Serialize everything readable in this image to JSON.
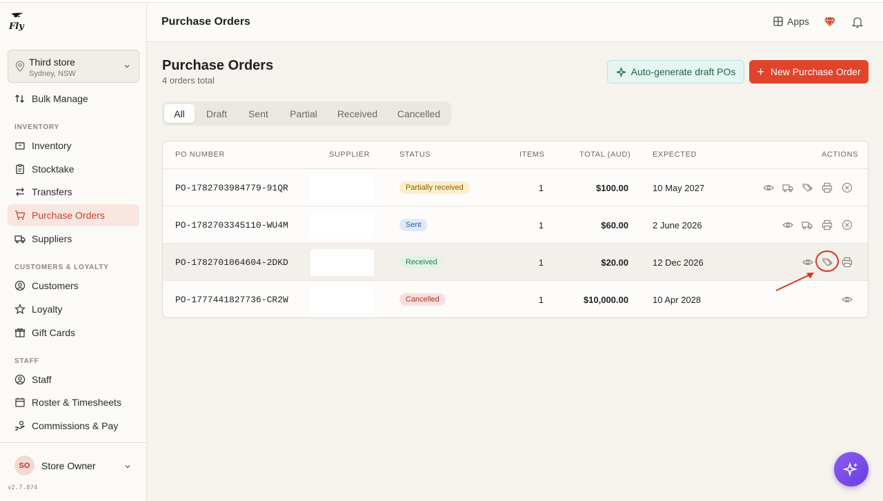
{
  "app": {
    "logo_text": "Fly",
    "version": "v2.7.874"
  },
  "store_selector": {
    "name": "Third store",
    "location": "Sydney, NSW"
  },
  "sidebar": {
    "bulk_manage": "Bulk Manage",
    "sections": [
      {
        "label": "INVENTORY",
        "items": [
          "Inventory",
          "Stocktake",
          "Transfers",
          "Purchase Orders",
          "Suppliers"
        ]
      },
      {
        "label": "CUSTOMERS & LOYALTY",
        "items": [
          "Customers",
          "Loyalty",
          "Gift Cards"
        ]
      },
      {
        "label": "STAFF",
        "items": [
          "Staff",
          "Roster & Timesheets",
          "Commissions & Pay"
        ]
      }
    ],
    "active_item": "Purchase Orders"
  },
  "user": {
    "initials": "SO",
    "name": "Store Owner"
  },
  "header": {
    "title": "Purchase Orders",
    "apps_label": "Apps"
  },
  "page": {
    "title": "Purchase Orders",
    "subtitle": "4 orders total",
    "auto_button": "Auto-generate draft POs",
    "new_button": "New Purchase Order"
  },
  "tabs": [
    "All",
    "Draft",
    "Sent",
    "Partial",
    "Received",
    "Cancelled"
  ],
  "active_tab": "All",
  "table": {
    "columns": [
      "PO NUMBER",
      "SUPPLIER",
      "STATUS",
      "ITEMS",
      "TOTAL (AUD)",
      "EXPECTED",
      "ACTIONS"
    ],
    "rows": [
      {
        "po": "PO-1782703984779-91QR",
        "status": "Partially received",
        "items": "1",
        "total": "$100.00",
        "expected": "10 May 2027"
      },
      {
        "po": "PO-1782703345110-WU4M",
        "status": "Sent",
        "items": "1",
        "total": "$60.00",
        "expected": "2 June 2026"
      },
      {
        "po": "PO-1782701064604-2DKD",
        "status": "Received",
        "items": "1",
        "total": "$20.00",
        "expected": "12 Dec 2026"
      },
      {
        "po": "PO-1777441827736-CR2W",
        "status": "Cancelled",
        "items": "1",
        "total": "$10,000.00",
        "expected": "10 Apr 2028"
      }
    ]
  },
  "colors": {
    "accent": "#e1432b",
    "active_nav_bg": "#f9e6e0",
    "fab": "#7b4de8"
  }
}
